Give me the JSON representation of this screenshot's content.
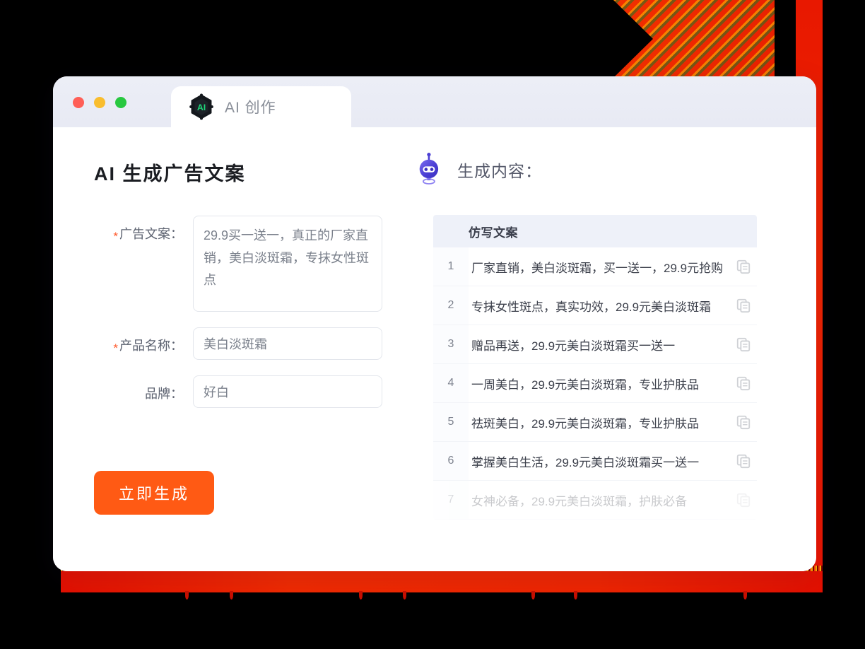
{
  "window": {
    "traffic_lights": [
      {
        "name": "close",
        "color": "#ff5f57"
      },
      {
        "name": "minimize",
        "color": "#f9bd2e"
      },
      {
        "name": "maximize",
        "color": "#28c840"
      }
    ],
    "tab": {
      "label": "AI 创作",
      "logo_text": "AI",
      "logo_icon": "ai-hexagon-icon"
    }
  },
  "left": {
    "title": "AI 生成广告文案",
    "fields": [
      {
        "label": "广告文案：",
        "required": true,
        "type": "textarea",
        "value": "29.9买一送一，真正的厂家直销，美白淡斑霜，专抹女性斑点"
      },
      {
        "label": "产品名称：",
        "required": true,
        "type": "input",
        "value": "美白淡斑霜"
      },
      {
        "label": "品牌：",
        "required": false,
        "type": "input",
        "value": "好白"
      }
    ],
    "submit_label": "立即生成"
  },
  "right": {
    "robot_icon": "robot-head-icon",
    "title": "生成内容：",
    "table": {
      "column_header": "仿写文案",
      "copy_icon": "copy-icon",
      "rows": [
        {
          "index": "1",
          "text": "厂家直销，美白淡斑霜，买一送一，29.9元抢购"
        },
        {
          "index": "2",
          "text": "专抹女性斑点，真实功效，29.9元美白淡斑霜"
        },
        {
          "index": "3",
          "text": "赠品再送，29.9元美白淡斑霜买一送一"
        },
        {
          "index": "4",
          "text": "一周美白，29.9元美白淡斑霜，专业护肤品"
        },
        {
          "index": "5",
          "text": "祛斑美白，29.9元美白淡斑霜，专业护肤品"
        },
        {
          "index": "6",
          "text": "掌握美白生活，29.9元美白淡斑霜买一送一"
        },
        {
          "index": "7",
          "text": "女神必备，29.9元美白淡斑霜，护肤必备"
        }
      ]
    }
  },
  "colors": {
    "accent_orange": "#ff5a14",
    "required_star": "#ff5a2c",
    "deco_red": "#ee2500",
    "robot_blue": "#4b3fd4",
    "logo_green": "#1ed97a",
    "table_header_bg": "#eef1f9"
  }
}
